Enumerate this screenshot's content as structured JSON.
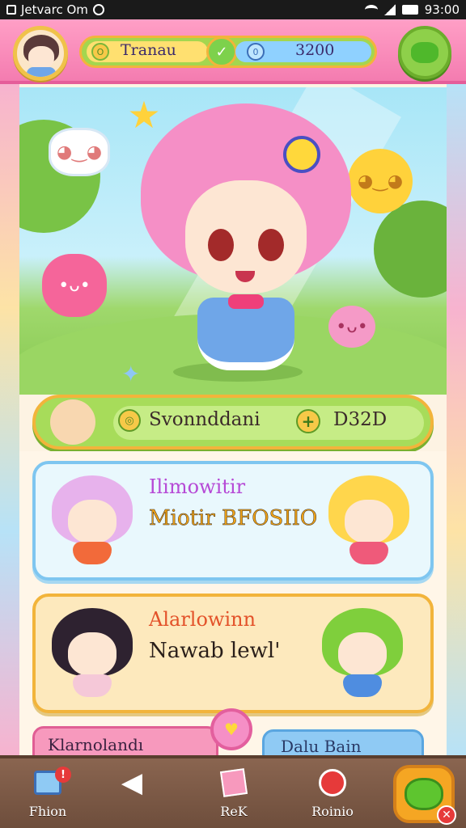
{
  "status_bar": {
    "left_text": "Jetvarc Om",
    "time": "93:00"
  },
  "top_bar": {
    "player_name": "Tranau",
    "currency_value": "3200",
    "coin_icon": "coin-icon",
    "gem_icon": "gem-icon"
  },
  "action_bar": {
    "title": "Svonnddani",
    "value": "D32D"
  },
  "cards": [
    {
      "label": "Ilimowitir",
      "subtitle": "Miotir BFOSIIO"
    },
    {
      "label": "Alarlowinn",
      "subtitle": "Nawab lewl'"
    }
  ],
  "tabs": [
    {
      "label": "Klarnolandı"
    },
    {
      "label": "Dalu Bain"
    }
  ],
  "bottom_nav": [
    {
      "label": "Fhion",
      "icon": "inbox-icon",
      "alert": "!"
    },
    {
      "label": "",
      "icon": "back-arrow-icon"
    },
    {
      "label": "ReK",
      "icon": "card-icon"
    },
    {
      "label": "Roinio",
      "icon": "chat-icon"
    }
  ],
  "colors": {
    "top_bar": "#f47cb0",
    "accent_green": "#a7dc5a",
    "accent_gold": "#f2b43b",
    "nav_bg": "#6e4e3c"
  }
}
